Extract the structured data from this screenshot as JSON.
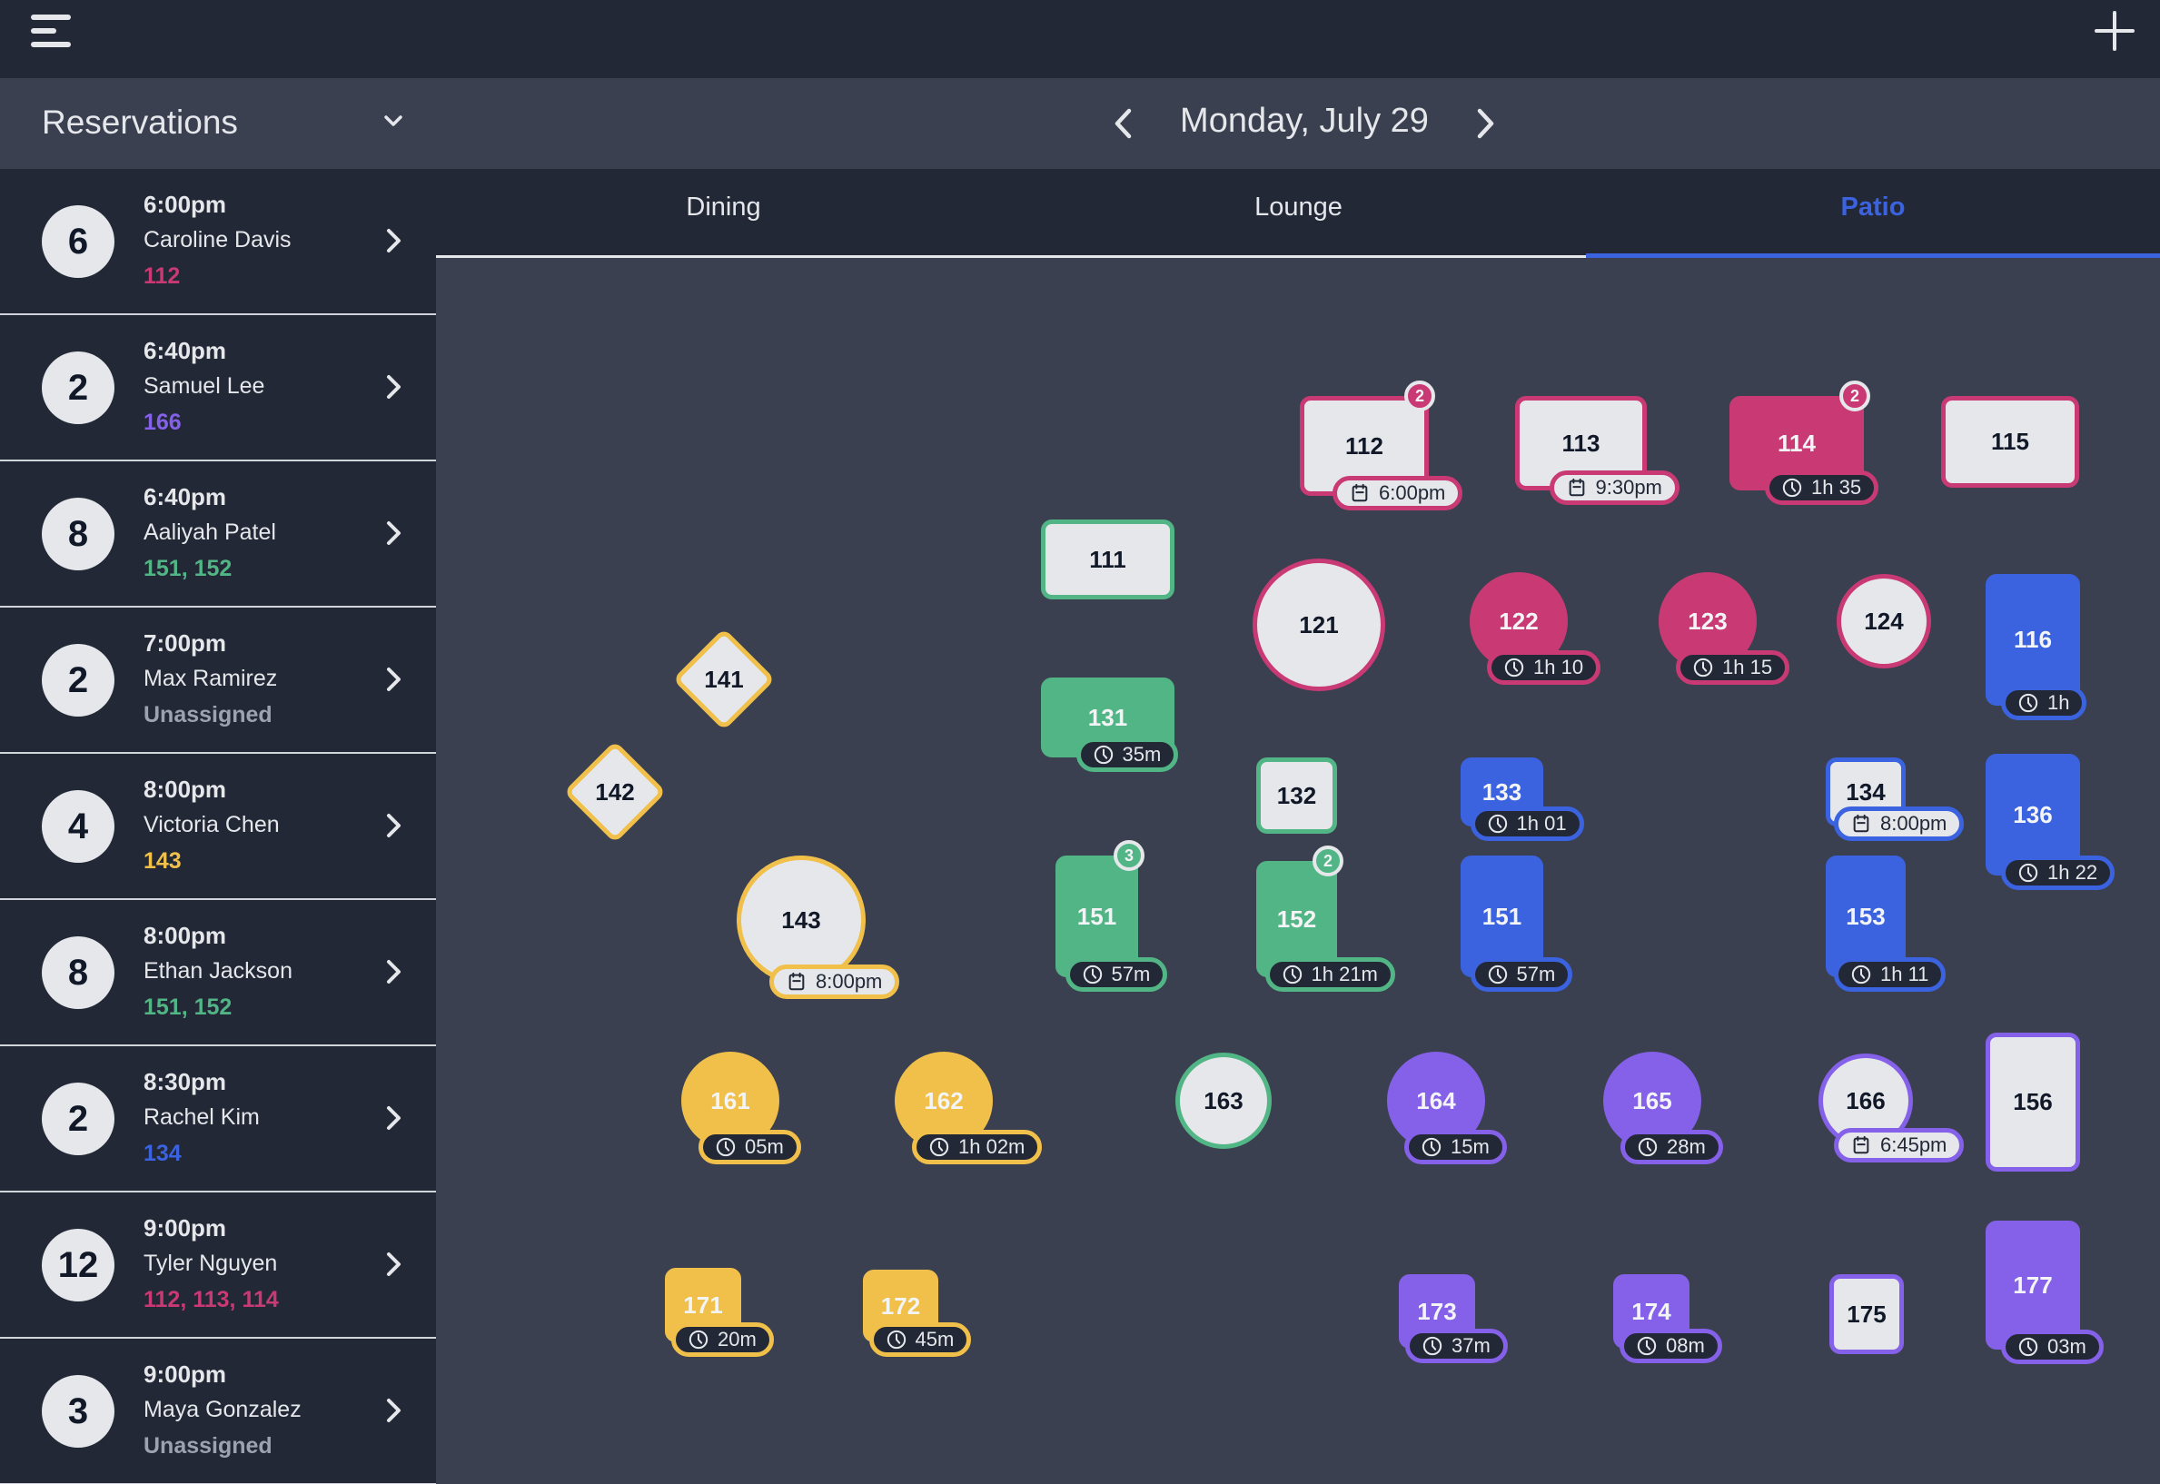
{
  "header": {
    "menu_icon": "hamburger-menu-icon",
    "add_icon": "plus-icon"
  },
  "subheader": {
    "view_select": "Reservations",
    "date": "Monday, July 29"
  },
  "colors": {
    "pink": "#c93a75",
    "green": "#52b585",
    "yellow": "#f0c04a",
    "blue": "#3b63e0",
    "purple": "#8560e8",
    "unassigned": "#9ca3af",
    "accent": "#3b63e0"
  },
  "reservations": [
    {
      "party": "6",
      "time": "6:00pm",
      "name": "Caroline Davis",
      "tables": "112",
      "color": "#c93a75"
    },
    {
      "party": "2",
      "time": "6:40pm",
      "name": "Samuel Lee",
      "tables": "166",
      "color": "#8560e8"
    },
    {
      "party": "8",
      "time": "6:40pm",
      "name": "Aaliyah Patel",
      "tables": "151, 152",
      "color": "#52b585"
    },
    {
      "party": "2",
      "time": "7:00pm",
      "name": "Max Ramirez",
      "tables": "Unassigned",
      "color": "#9ca3af"
    },
    {
      "party": "4",
      "time": "8:00pm",
      "name": "Victoria Chen",
      "tables": "143",
      "color": "#f0c04a"
    },
    {
      "party": "8",
      "time": "8:00pm",
      "name": "Ethan Jackson",
      "tables": "151, 152",
      "color": "#52b585"
    },
    {
      "party": "2",
      "time": "8:30pm",
      "name": "Rachel Kim",
      "tables": "134",
      "color": "#3b63e0"
    },
    {
      "party": "12",
      "time": "9:00pm",
      "name": "Tyler Nguyen",
      "tables": "112, 113, 114",
      "color": "#c93a75"
    },
    {
      "party": "3",
      "time": "9:00pm",
      "name": "Maya Gonzalez",
      "tables": "Unassigned",
      "color": "#9ca3af"
    }
  ],
  "tabs": [
    {
      "label": "Dining",
      "active": false
    },
    {
      "label": "Lounge",
      "active": false
    },
    {
      "label": "Patio",
      "active": true
    }
  ],
  "tables": {
    "t112": {
      "label": "112",
      "color": "#c93a75",
      "occupied": false,
      "count": "2",
      "pill_type": "reservation",
      "pill_text": "6:00pm"
    },
    "t113": {
      "label": "113",
      "color": "#c93a75",
      "occupied": false,
      "pill_type": "reservation",
      "pill_text": "9:30pm"
    },
    "t114": {
      "label": "114",
      "color": "#c93a75",
      "occupied": true,
      "count": "2",
      "pill_type": "timer",
      "pill_text": "1h 35"
    },
    "t115": {
      "label": "115",
      "color": "#c93a75",
      "occupied": false
    },
    "t111": {
      "label": "111",
      "color": "#52b585",
      "occupied": false
    },
    "t121": {
      "label": "121",
      "color": "#c93a75",
      "occupied": false
    },
    "t122": {
      "label": "122",
      "color": "#c93a75",
      "occupied": true,
      "pill_type": "timer",
      "pill_text": "1h 10"
    },
    "t123": {
      "label": "123",
      "color": "#c93a75",
      "occupied": true,
      "pill_type": "timer",
      "pill_text": "1h 15"
    },
    "t124": {
      "label": "124",
      "color": "#c93a75",
      "occupied": false
    },
    "t116": {
      "label": "116",
      "color": "#3b63e0",
      "occupied": true,
      "pill_type": "timer",
      "pill_text": "1h"
    },
    "t131": {
      "label": "131",
      "color": "#52b585",
      "occupied": true,
      "pill_type": "timer",
      "pill_text": "35m"
    },
    "t132": {
      "label": "132",
      "color": "#52b585",
      "occupied": false
    },
    "t133": {
      "label": "133",
      "color": "#3b63e0",
      "occupied": true,
      "pill_type": "timer",
      "pill_text": "1h 01"
    },
    "t134": {
      "label": "134",
      "color": "#3b63e0",
      "occupied": false,
      "pill_type": "reservation",
      "pill_text": "8:00pm"
    },
    "t136": {
      "label": "136",
      "color": "#3b63e0",
      "occupied": true,
      "pill_type": "timer",
      "pill_text": "1h 22"
    },
    "t141": {
      "label": "141",
      "color": "#f0c04a",
      "occupied": false
    },
    "t142": {
      "label": "142",
      "color": "#f0c04a",
      "occupied": false
    },
    "t143": {
      "label": "143",
      "color": "#f0c04a",
      "occupied": false,
      "pill_type": "reservation",
      "pill_text": "8:00pm"
    },
    "t151g": {
      "label": "151",
      "color": "#52b585",
      "occupied": true,
      "count": "3",
      "pill_type": "timer",
      "pill_text": "57m"
    },
    "t152": {
      "label": "152",
      "color": "#52b585",
      "occupied": true,
      "count": "2",
      "pill_type": "timer",
      "pill_text": "1h 21m"
    },
    "t151b": {
      "label": "151",
      "color": "#3b63e0",
      "occupied": true,
      "pill_type": "timer",
      "pill_text": "57m"
    },
    "t153": {
      "label": "153",
      "color": "#3b63e0",
      "occupied": true,
      "pill_type": "timer",
      "pill_text": "1h 11"
    },
    "t161": {
      "label": "161",
      "color": "#f0c04a",
      "occupied": true,
      "pill_type": "timer",
      "pill_text": "05m"
    },
    "t162": {
      "label": "162",
      "color": "#f0c04a",
      "occupied": true,
      "pill_type": "timer",
      "pill_text": "1h 02m"
    },
    "t163": {
      "label": "163",
      "color": "#52b585",
      "occupied": false
    },
    "t164": {
      "label": "164",
      "color": "#8560e8",
      "occupied": true,
      "pill_type": "timer",
      "pill_text": "15m"
    },
    "t165": {
      "label": "165",
      "color": "#8560e8",
      "occupied": true,
      "pill_type": "timer",
      "pill_text": "28m"
    },
    "t166": {
      "label": "166",
      "color": "#8560e8",
      "occupied": false,
      "pill_type": "reservation",
      "pill_text": "6:45pm"
    },
    "t156": {
      "label": "156",
      "color": "#8560e8",
      "occupied": false
    },
    "t171": {
      "label": "171",
      "color": "#f0c04a",
      "occupied": true,
      "pill_type": "timer",
      "pill_text": "20m"
    },
    "t172": {
      "label": "172",
      "color": "#f0c04a",
      "occupied": true,
      "pill_type": "timer",
      "pill_text": "45m"
    },
    "t173": {
      "label": "173",
      "color": "#8560e8",
      "occupied": true,
      "pill_type": "timer",
      "pill_text": "37m"
    },
    "t174": {
      "label": "174",
      "color": "#8560e8",
      "occupied": true,
      "pill_type": "timer",
      "pill_text": "08m"
    },
    "t175": {
      "label": "175",
      "color": "#8560e8",
      "occupied": false
    },
    "t177": {
      "label": "177",
      "color": "#8560e8",
      "occupied": true,
      "pill_type": "timer",
      "pill_text": "03m"
    }
  }
}
